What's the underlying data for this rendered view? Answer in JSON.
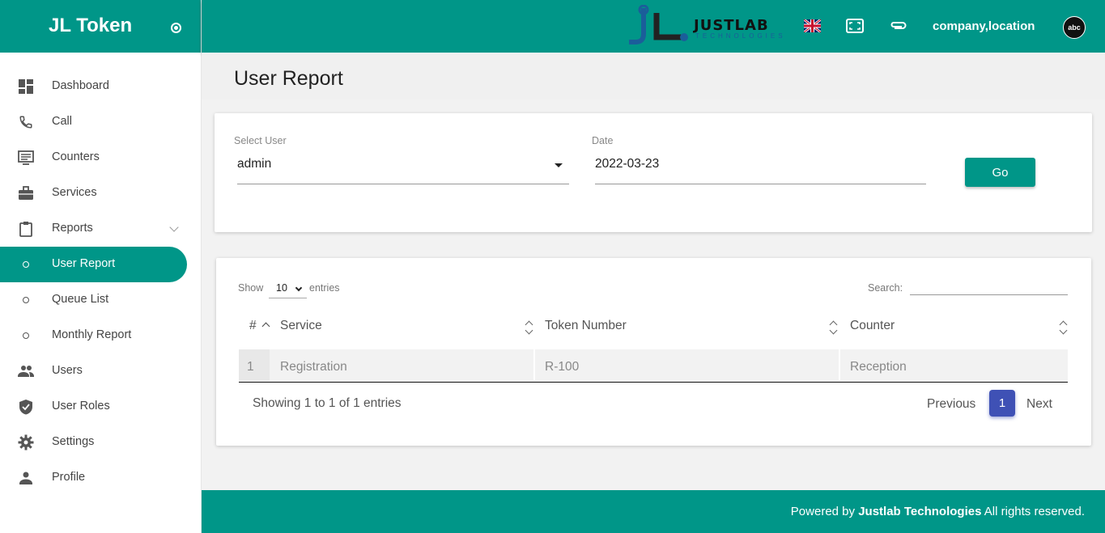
{
  "app": {
    "title": "JL Token"
  },
  "sidebar": {
    "items": [
      {
        "label": "Dashboard",
        "icon": "dashboard-icon"
      },
      {
        "label": "Call",
        "icon": "phone-icon"
      },
      {
        "label": "Counters",
        "icon": "counter-icon"
      },
      {
        "label": "Services",
        "icon": "briefcase-icon"
      },
      {
        "label": "Reports",
        "icon": "clipboard-icon"
      },
      {
        "label": "User Report",
        "icon": "circle-icon"
      },
      {
        "label": "Queue List",
        "icon": "circle-icon"
      },
      {
        "label": "Monthly Report",
        "icon": "circle-icon"
      },
      {
        "label": "Users",
        "icon": "users-icon"
      },
      {
        "label": "User Roles",
        "icon": "shield-icon"
      },
      {
        "label": "Settings",
        "icon": "gear-icon"
      },
      {
        "label": "Profile",
        "icon": "person-icon"
      }
    ],
    "active": "User Report"
  },
  "topbar": {
    "logo_word": "JUSTLAB",
    "logo_sub": "TECHNOLOGIES",
    "company": "company,location",
    "avatar_text": "abc"
  },
  "page": {
    "title": "User Report"
  },
  "filters": {
    "user_label": "Select User",
    "user_value": "admin",
    "date_label": "Date",
    "date_value": "2022-03-23",
    "go_label": "Go"
  },
  "table": {
    "show_label": "Show",
    "entries_value": "10",
    "entries_label": "entries",
    "search_label": "Search:",
    "columns": [
      "#",
      "Service",
      "Token Number",
      "Counter"
    ],
    "rows": [
      {
        "index": "1",
        "service": "Registration",
        "token": "R-100",
        "counter": "Reception"
      }
    ],
    "showing": "Showing 1 to 1 of 1 entries",
    "prev_label": "Previous",
    "page": "1",
    "next_label": "Next"
  },
  "footer": {
    "prefix": "Powered by",
    "brand": "Justlab Technologies",
    "suffix": "All rights reserved."
  },
  "colors": {
    "primary": "#009688",
    "page_active": "#3f51b5"
  }
}
